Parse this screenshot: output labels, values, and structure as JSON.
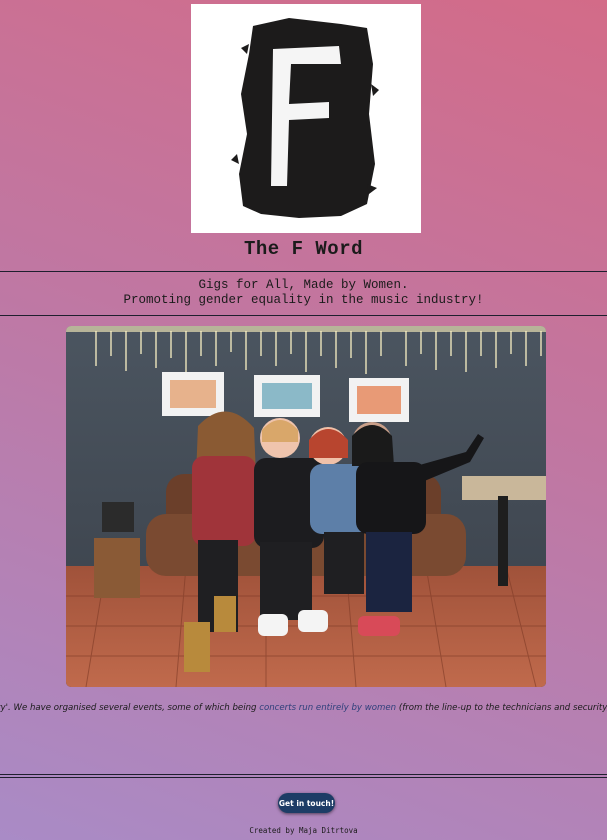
{
  "header": {
    "logo_letter": "F",
    "title": "The F Word"
  },
  "tagline": {
    "line1": "Gigs for All, Made by Women.",
    "line2": "Promoting gender equality in the music industry!"
  },
  "hero_photo": {
    "icon": "group-photo-four-women-on-sofa"
  },
  "ticker": {
    "part1": "ility'. We have organised several events, some of which being ",
    "highlight": "concerts run entirely by women",
    "part2": " (from the line-up to the technicians and security) and holding"
  },
  "footer": {
    "cta_label": "Get in touch!",
    "credit": "Created by Maja Ditrtova"
  },
  "colors": {
    "cta_bg": "#1d3c66",
    "highlight_text": "#2e3f7a",
    "bg_top": "#d36b88",
    "bg_bottom": "#a98bc6"
  }
}
